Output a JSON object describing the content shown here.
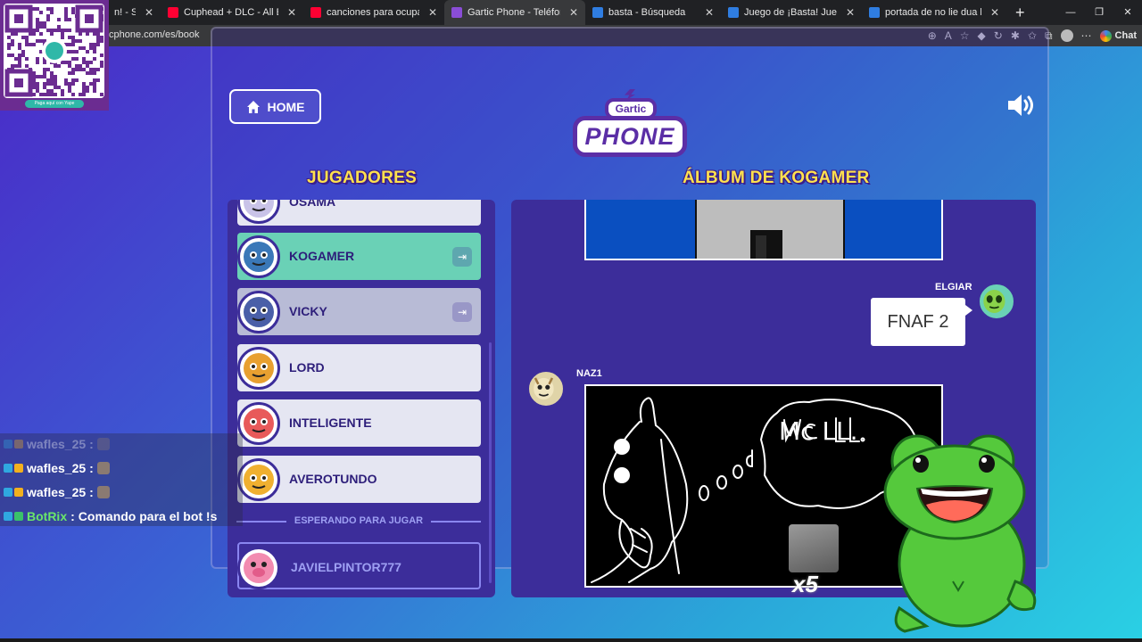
{
  "browser": {
    "tabs": [
      {
        "title": "n! - Studiop",
        "color": "#ffffff",
        "active": false
      },
      {
        "title": "Cuphead + DLC - All Bosses S",
        "color": "#ff0033",
        "active": false
      },
      {
        "title": "canciones para ocupar una cabeza",
        "color": "#ff0033",
        "active": false
      },
      {
        "title": "Gartic Phone - Teléfono Descomp",
        "color": "#8a4dd6",
        "active": true
      },
      {
        "title": "basta - Búsqueda",
        "color": "#2f7de1",
        "active": false
      },
      {
        "title": "Juego de ¡Basta! Juega Stop, Tutti",
        "color": "#2f7de1",
        "active": false
      },
      {
        "title": "portada de no lie dua lipa - Búsq",
        "color": "#2f7de1",
        "active": false
      }
    ],
    "url": "cphone.com/es/book",
    "chat_label": "Chat"
  },
  "header": {
    "home_label": "HOME",
    "logo_top": "Gartic",
    "logo_bottom": "PHONE"
  },
  "players": {
    "title": "JUGADORES",
    "list": [
      {
        "name": "OSAMA",
        "state": "normal",
        "avatar_color": "#c9c3e8"
      },
      {
        "name": "KOGAMER",
        "state": "me",
        "avatar_color": "#3a78b8"
      },
      {
        "name": "VICKY",
        "state": "dim",
        "avatar_color": "#4a5fa8"
      },
      {
        "name": "LORD",
        "state": "normal",
        "avatar_color": "#e8a030"
      },
      {
        "name": "INTELIGENTE",
        "state": "normal",
        "avatar_color": "#e85a5a"
      },
      {
        "name": "AVEROTUNDO",
        "state": "normal",
        "avatar_color": "#f0b030"
      }
    ],
    "waiting_label": "ESPERANDO PARA JUGAR",
    "waiting": [
      {
        "name": "JAVIELPINTOR777",
        "avatar_color": "#f28bb0"
      }
    ]
  },
  "album": {
    "title": "ÁLBUM DE KOGAMER",
    "entries": [
      {
        "type": "drawing",
        "author": ""
      },
      {
        "type": "text",
        "author": "ELGIAR",
        "text": "FNAF 2"
      },
      {
        "type": "drawing",
        "author": "NAZ1",
        "scribble_text": "Mc LL."
      }
    ]
  },
  "chat": {
    "lines": [
      {
        "user": "wafles_25",
        "msg": "",
        "faded": true
      },
      {
        "user": "wafles_25",
        "msg": "",
        "faded": false
      },
      {
        "user": "wafles_25",
        "msg": "",
        "faded": false
      },
      {
        "user": "BotRix",
        "msg": "Comando para el bot !s",
        "faded": false
      }
    ]
  },
  "overlay": {
    "qr_caption": "Paga aquí con Yape",
    "sticker_count": "x5"
  },
  "colors": {
    "accent_yellow": "#ffe14d",
    "panel": "#3c2d9a",
    "me_row": "#6ad1b6"
  }
}
